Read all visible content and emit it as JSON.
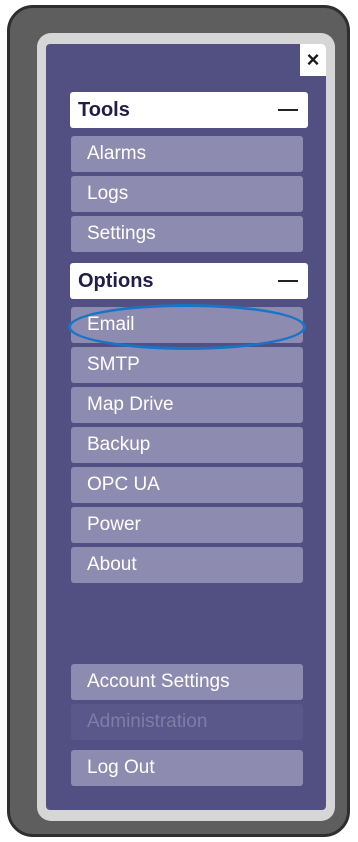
{
  "menu": {
    "close_symbol": "×",
    "tools": {
      "header": "Tools",
      "collapse_symbol": "—",
      "items": [
        "Alarms",
        "Logs",
        "Settings"
      ]
    },
    "options": {
      "header": "Options",
      "collapse_symbol": "—",
      "items": [
        "Email",
        "SMTP",
        "Map Drive",
        "Backup",
        "OPC UA",
        "Power",
        "About"
      ]
    },
    "account": {
      "items": [
        {
          "label": "Account Settings",
          "enabled": true
        },
        {
          "label": "Administration",
          "enabled": false
        },
        {
          "label": "Log Out",
          "enabled": true
        }
      ]
    }
  },
  "annotation": {
    "highlighted_item": "Email",
    "color": "#1a74c6"
  }
}
